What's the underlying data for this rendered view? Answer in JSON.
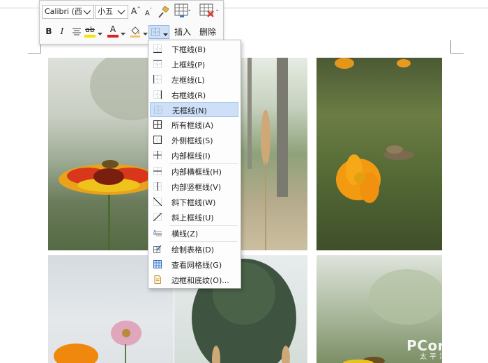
{
  "toolbar": {
    "font_name": "Calibri (西文",
    "font_size": "小五",
    "grow_font_label": "A",
    "shrink_font_label": "A",
    "bold_label": "B",
    "italic_label": "I",
    "highlight_label": "ab",
    "font_color_label": "A",
    "insert_label": "插入",
    "delete_label": "删除"
  },
  "border_menu": {
    "items": [
      {
        "label": "下框线(B)",
        "icon": "border-bottom-icon",
        "selected": false
      },
      {
        "label": "上框线(P)",
        "icon": "border-top-icon",
        "selected": false
      },
      {
        "label": "左框线(L)",
        "icon": "border-left-icon",
        "selected": false
      },
      {
        "label": "右框线(R)",
        "icon": "border-right-icon",
        "selected": false
      },
      {
        "label": "无框线(N)",
        "icon": "border-none-icon",
        "selected": true
      },
      {
        "label": "所有框线(A)",
        "icon": "border-all-icon",
        "selected": false
      },
      {
        "label": "外侧框线(S)",
        "icon": "border-outside-icon",
        "selected": false
      },
      {
        "label": "内部框线(I)",
        "icon": "border-inside-icon",
        "selected": false
      },
      {
        "label": "内部横框线(H)",
        "icon": "border-inside-horizontal-icon",
        "selected": false
      },
      {
        "label": "内部竖框线(V)",
        "icon": "border-inside-vertical-icon",
        "selected": false
      },
      {
        "label": "斜下框线(W)",
        "icon": "diagonal-down-border-icon",
        "selected": false
      },
      {
        "label": "斜上框线(U)",
        "icon": "diagonal-up-border-icon",
        "selected": false
      },
      {
        "label": "横线(Z)",
        "icon": "horizontal-line-icon",
        "selected": false
      },
      {
        "label": "绘制表格(D)",
        "icon": "draw-table-icon",
        "selected": false
      },
      {
        "label": "查看网格线(G)",
        "icon": "view-gridlines-icon",
        "selected": false
      },
      {
        "label": "边框和底纹(O)...",
        "icon": "borders-shading-icon",
        "selected": false
      }
    ]
  },
  "watermark": {
    "brand": "PConline",
    "sub": "太平洋电脑网"
  },
  "colors": {
    "highlight": "#f5e400",
    "font_color": "#e02020",
    "menu_selected": "#cde0f7",
    "delete_red": "#d83020"
  }
}
